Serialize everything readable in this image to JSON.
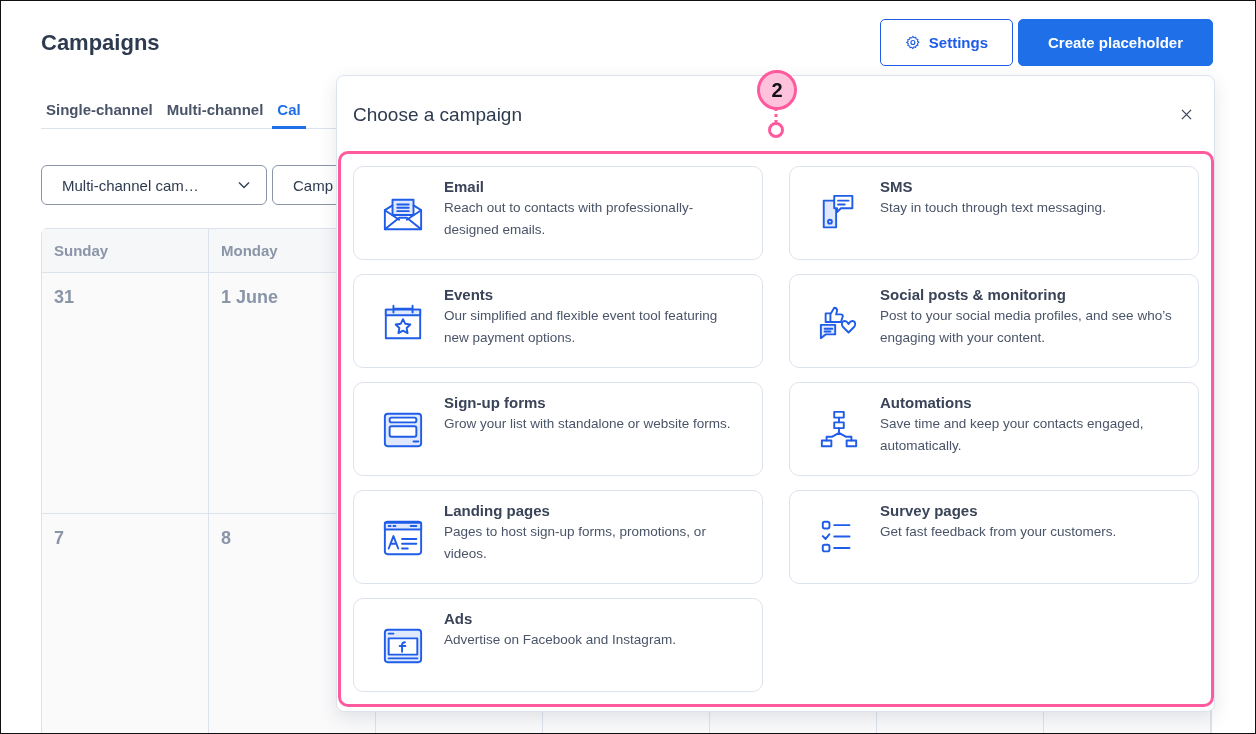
{
  "page": {
    "title": "Campaigns"
  },
  "header_buttons": [
    {
      "label": "Settings",
      "kind": "outline"
    },
    {
      "label": "Create placeholder",
      "kind": "primary"
    }
  ],
  "tabs": [
    {
      "label": "Single-channel",
      "selected": false
    },
    {
      "label": "Multi-channel",
      "selected": false
    },
    {
      "label": "Cal",
      "selected": true
    }
  ],
  "filters": [
    {
      "value": "Multi-channel cam…",
      "kind": "dropdown"
    },
    {
      "value": "Camp",
      "kind": "covered"
    }
  ],
  "calendar": {
    "weekdays": [
      "Sunday",
      "Monday"
    ],
    "weeks": [
      [
        "31",
        "1 June"
      ],
      [
        "7",
        "8"
      ]
    ]
  },
  "dialog": {
    "title": "Choose a campaign",
    "annotation": "2",
    "options": [
      {
        "kind": "email",
        "title": "Email",
        "description": "Reach out to contacts with professionally-designed emails."
      },
      {
        "kind": "sms",
        "title": "SMS",
        "description": "Stay in touch through text messaging."
      },
      {
        "kind": "events",
        "title": "Events",
        "description": "Our simplified and flexible event tool featuring new payment options."
      },
      {
        "kind": "social",
        "title": "Social posts & monitoring",
        "description": "Post to your social media profiles, and see who’s engaging with your content."
      },
      {
        "kind": "forms",
        "title": "Sign-up forms",
        "description": "Grow your list with standalone or website forms."
      },
      {
        "kind": "automations",
        "title": "Automations",
        "description": "Save time and keep your contacts engaged, automatically."
      },
      {
        "kind": "landing",
        "title": "Landing pages",
        "description": "Pages to host sign-up forms, promotions, or videos."
      },
      {
        "kind": "survey",
        "title": "Survey pages",
        "description": "Get fast feedback from your customers."
      },
      {
        "kind": "ads",
        "title": "Ads",
        "description": "Advertise on Facebook and Instagram."
      }
    ]
  }
}
